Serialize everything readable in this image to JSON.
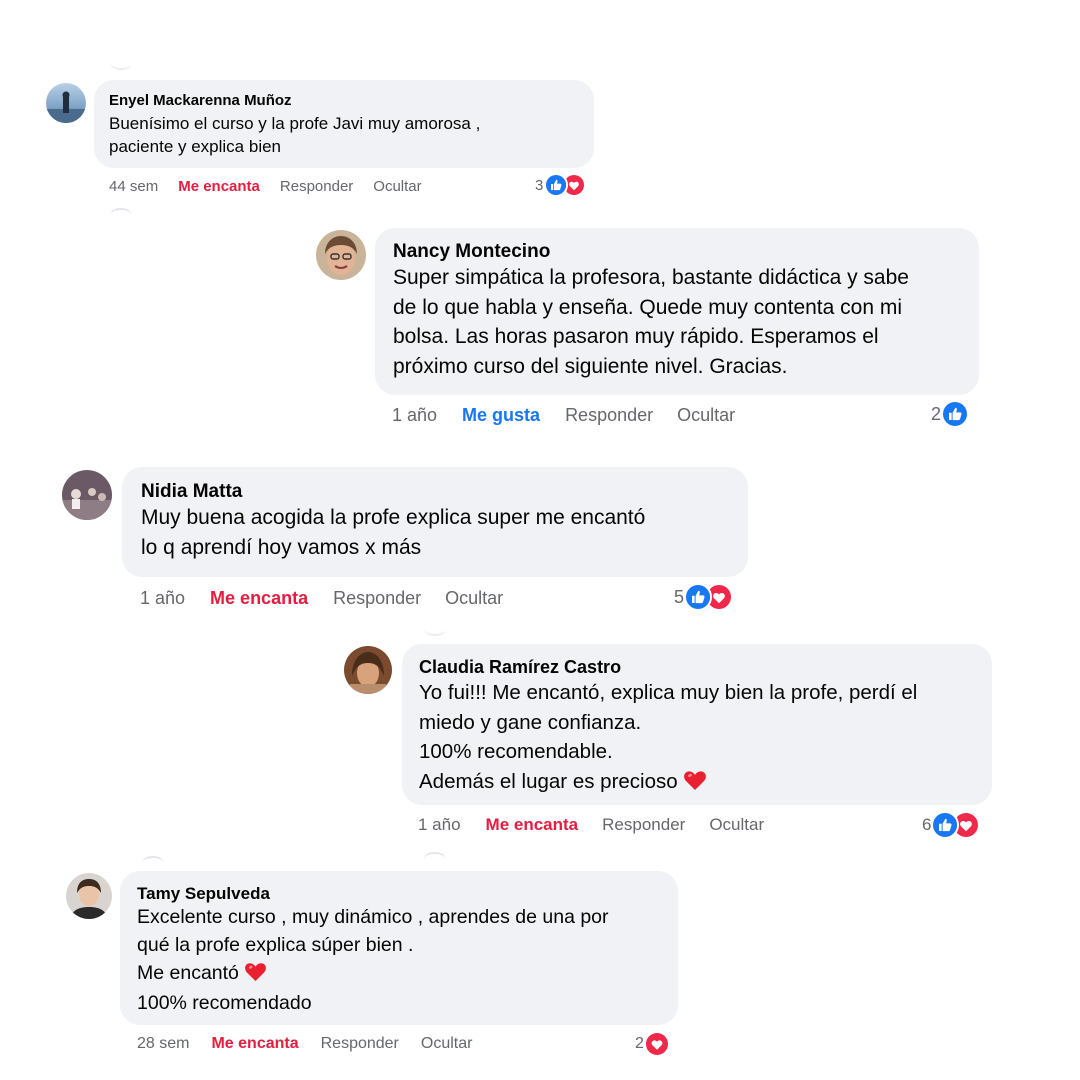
{
  "colors": {
    "bubble": "#f0f2f5",
    "like": "#1877f2",
    "love": "#e41e3f",
    "meta": "#65676b"
  },
  "actions": {
    "reply": "Responder",
    "hide": "Ocultar"
  },
  "comments": [
    {
      "author": "Enyel Mackarenna Muñoz",
      "lines": [
        "Buenísimo el curso y la profe Javi muy amorosa ,",
        "paciente y explica bien"
      ],
      "time": "44 sem",
      "reaction_label": "Me encanta",
      "reaction_type": "love",
      "count": "3",
      "icons": [
        "like-icon",
        "love-icon"
      ]
    },
    {
      "author": "Nancy Montecino",
      "lines": [
        "Super simpática la profesora, bastante didáctica y sabe",
        "de lo que habla y enseña. Quede muy contenta con mi",
        "bolsa. Las horas pasaron muy rápido. Esperamos el",
        "próximo curso del siguiente nivel. Gracias."
      ],
      "time": "1 año",
      "reaction_label": "Me gusta",
      "reaction_type": "like",
      "count": "2",
      "icons": [
        "like-icon"
      ]
    },
    {
      "author": "Nidia Matta",
      "lines": [
        "Muy buena acogida la profe explica super me encantó",
        "lo q aprendí hoy vamos x más"
      ],
      "time": "1 año",
      "reaction_label": "Me encanta",
      "reaction_type": "love",
      "count": "5",
      "icons": [
        "like-icon",
        "love-icon"
      ]
    },
    {
      "author": "Claudia Ramírez Castro",
      "lines": [
        "Yo fui!!! Me encantó, explica muy bien la profe, perdí el",
        "miedo y gane confianza.",
        "100% recomendable.",
        "Además el lugar es precioso"
      ],
      "time": "1 año",
      "reaction_label": "Me encanta",
      "reaction_type": "love",
      "count": "6",
      "icons": [
        "like-icon",
        "love-icon"
      ]
    },
    {
      "author": "Tamy Sepulveda",
      "lines": [
        "Excelente curso , muy dinámico , aprendes de una por",
        "qué la profe explica súper bien .",
        "Me encantó",
        "100% recomendado"
      ],
      "time": "28 sem",
      "reaction_label": "Me encanta",
      "reaction_type": "love",
      "count": "2",
      "icons": [
        "love-icon"
      ]
    }
  ]
}
